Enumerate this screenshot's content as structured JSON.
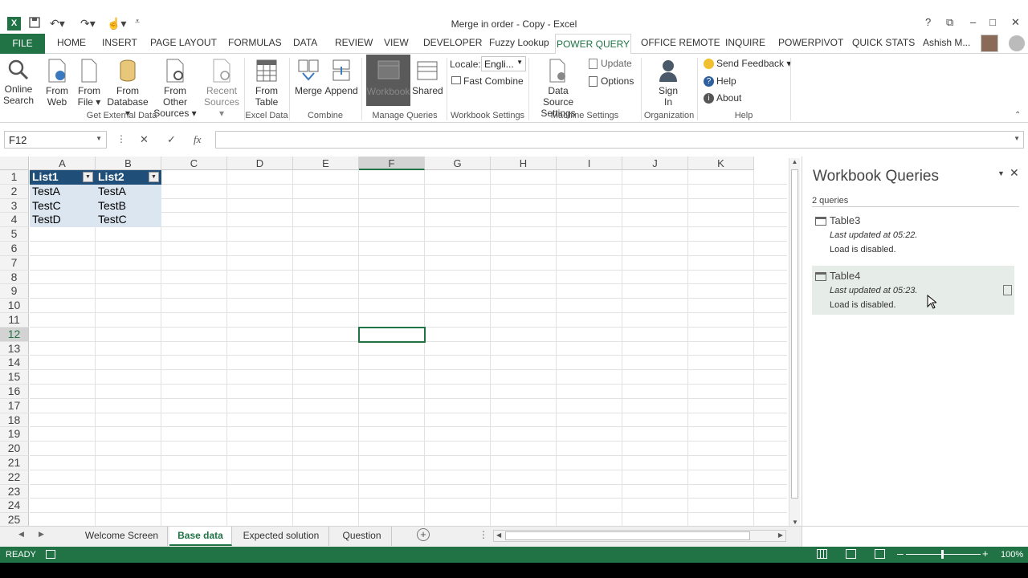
{
  "window": {
    "title": "Merge in order - Copy - Excel"
  },
  "qat": {
    "save_icon": "save-icon",
    "undo_icon": "undo-icon",
    "redo_icon": "redo-icon",
    "touch_icon": "touch-icon"
  },
  "window_controls": {
    "help": "?",
    "restore_ribbon": "⧉",
    "minimize": "–",
    "maximize": "□",
    "close": "✕"
  },
  "tabs": {
    "file": "FILE",
    "home": "HOME",
    "insert": "INSERT",
    "page_layout": "PAGE LAYOUT",
    "formulas": "FORMULAS",
    "data": "DATA",
    "review": "REVIEW",
    "view": "VIEW",
    "developer": "DEVELOPER",
    "fuzzy": "Fuzzy Lookup",
    "power_query": "POWER QUERY",
    "office_remote": "OFFICE REMOTE",
    "inquire": "INQUIRE",
    "powerpivot": "POWERPIVOT",
    "quick_stats": "QUICK STATS",
    "user": "Ashish M..."
  },
  "ribbon": {
    "online_search": [
      "Online",
      "Search"
    ],
    "from_web": [
      "From",
      "Web"
    ],
    "from_file": [
      "From",
      "File ▾"
    ],
    "from_database": [
      "From",
      "Database ▾"
    ],
    "from_other": [
      "From Other",
      "Sources ▾"
    ],
    "recent_sources": [
      "Recent",
      "Sources ▾"
    ],
    "from_table": [
      "From",
      "Table"
    ],
    "merge": "Merge",
    "append": "Append",
    "workbook": "Workbook",
    "shared": "Shared",
    "locale_label": "Locale:",
    "locale_value": "Engli...",
    "fast_combine": "Fast Combine",
    "data_source_settings": [
      "Data Source",
      "Settings"
    ],
    "update": "Update",
    "options": "Options",
    "sign_in": [
      "Sign",
      "In"
    ],
    "send_feedback": "Send Feedback ▾",
    "help": "Help",
    "about": "About",
    "groups": {
      "get_external": "Get External Data",
      "excel_data": "Excel Data",
      "combine": "Combine",
      "manage": "Manage Queries",
      "workbook_settings": "Workbook Settings",
      "machine_settings": "Machine Settings",
      "organization": "Organization",
      "help": "Help"
    }
  },
  "formula_bar": {
    "name_box": "F12",
    "cancel": "✕",
    "enter": "✓",
    "fx": "fx",
    "value": ""
  },
  "sheet": {
    "columns": [
      "A",
      "B",
      "C",
      "D",
      "E",
      "F",
      "G",
      "H",
      "I",
      "J",
      "K"
    ],
    "rows": [
      "1",
      "2",
      "3",
      "4",
      "5",
      "6",
      "7",
      "8",
      "9",
      "10",
      "11",
      "12",
      "13",
      "14",
      "15",
      "16",
      "17",
      "18",
      "19",
      "20",
      "21",
      "22",
      "23",
      "24",
      "25"
    ],
    "cells": {
      "A1": "List1",
      "B1": "List2",
      "A2": "TestA",
      "B2": "TestA",
      "A3": "TestC",
      "B3": "TestB",
      "A4": "TestD",
      "B4": "TestC"
    },
    "selected": "F12"
  },
  "panel": {
    "title": "Workbook Queries",
    "count": "2 queries",
    "queries": [
      {
        "name": "Table3",
        "updated": "Last updated at 05:22.",
        "load": "Load is disabled."
      },
      {
        "name": "Table4",
        "updated": "Last updated at 05:23.",
        "load": "Load is disabled."
      }
    ]
  },
  "sheet_tabs": [
    "Welcome Screen",
    "Base data",
    "Expected solution",
    "Question"
  ],
  "active_sheet": "Base data",
  "status": {
    "ready": "READY",
    "zoom": "100%"
  },
  "colors": {
    "excel_green": "#217346",
    "table_header": "#1f4e79",
    "table_band": "#dce6f1"
  }
}
